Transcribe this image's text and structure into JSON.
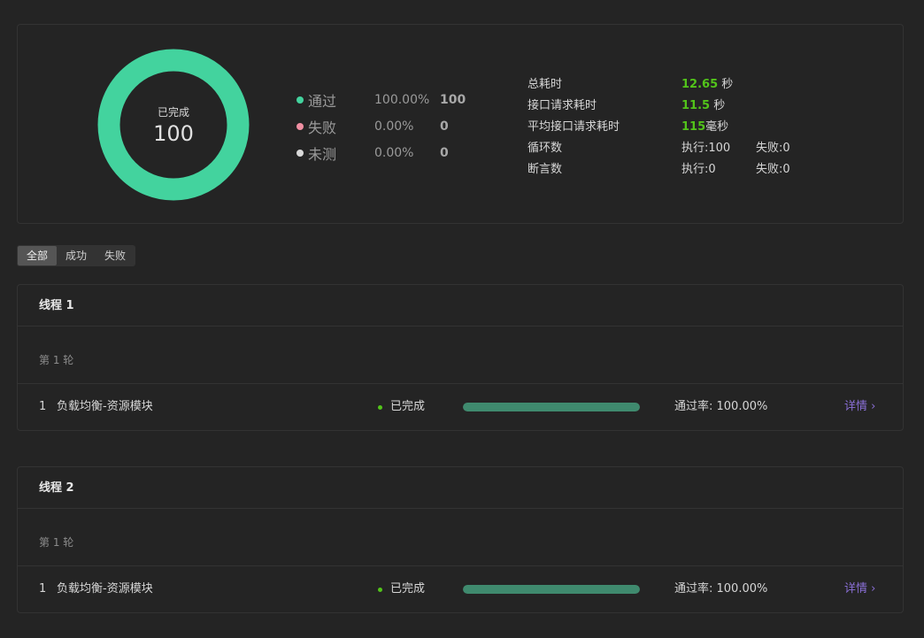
{
  "summary": {
    "donut": {
      "label": "已完成",
      "value": "100",
      "color": "#43d39e"
    },
    "legend": [
      {
        "name": "通过",
        "pct": "100.00%",
        "count": "100",
        "color": "#43d39e"
      },
      {
        "name": "失败",
        "pct": "0.00%",
        "count": "0",
        "color": "#f08fa2"
      },
      {
        "name": "未测",
        "pct": "0.00%",
        "count": "0",
        "color": "#d9d9d9"
      }
    ],
    "stats": {
      "total_time_label": "总耗时",
      "total_time_value": "12.65",
      "total_time_unit": " 秒",
      "api_time_label": "接口请求耗时",
      "api_time_value": "11.5",
      "api_time_unit": " 秒",
      "avg_time_label": "平均接口请求耗时",
      "avg_time_value": "115",
      "avg_time_unit": "毫秒",
      "loops_label": "循环数",
      "loops_exec": "执行:100",
      "loops_fail": "失败:0",
      "asserts_label": "断言数",
      "asserts_exec": "执行:0",
      "asserts_fail": "失败:0"
    }
  },
  "filter": {
    "all": "全部",
    "success": "成功",
    "fail": "失败"
  },
  "threads": [
    {
      "title": "线程 1",
      "round": "第 1 轮",
      "task": {
        "index": "1",
        "name": "负载均衡-资源模块",
        "status": "已完成",
        "progress": 1.0,
        "pass_rate": "通过率: 100.00%",
        "detail": "详情 ›"
      }
    },
    {
      "title": "线程 2",
      "round": "第 1 轮",
      "task": {
        "index": "1",
        "name": "负载均衡-资源模块",
        "status": "已完成",
        "progress": 1.0,
        "pass_rate": "通过率: 100.00%",
        "detail": "详情 ›"
      }
    }
  ]
}
